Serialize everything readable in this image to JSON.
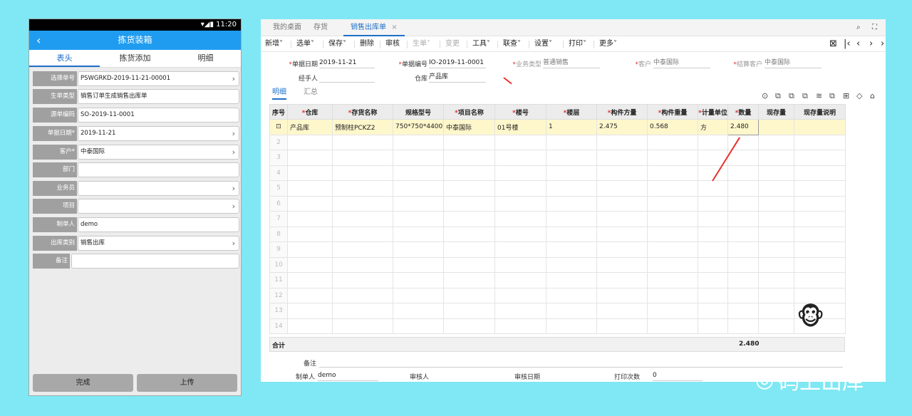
{
  "phone": {
    "status_time": "11:20",
    "status_icons": "▾◢▮",
    "back_icon": "‹",
    "title": "拣货装箱",
    "tabs": [
      "表头",
      "拣货添加",
      "明细"
    ],
    "fields": [
      {
        "label": "选择单号",
        "value": "PSWGRKD-2019-11-21-00001",
        "chevron": true
      },
      {
        "label": "生单类型",
        "value": "销售订单生成销售出库单",
        "chevron": false
      },
      {
        "label": "源单编码",
        "value": "SO-2019-11-0001",
        "chevron": false
      },
      {
        "label": "单据日期*",
        "value": "2019-11-21",
        "chevron": true
      },
      {
        "label": "客户*",
        "value": "中泰国际",
        "chevron": true
      },
      {
        "label": "部门",
        "value": "",
        "chevron": false
      },
      {
        "label": "业务员",
        "value": "",
        "chevron": true
      },
      {
        "label": "项目",
        "value": "",
        "chevron": true
      },
      {
        "label": "制单人",
        "value": "demo",
        "chevron": false
      },
      {
        "label": "出库类别",
        "value": "销售出库",
        "chevron": true
      },
      {
        "label": "备注",
        "value": "",
        "chevron": false
      }
    ],
    "btn_done": "完成",
    "btn_upload": "上传"
  },
  "desk": {
    "tabs": [
      "我的桌面",
      "存货",
      "销售出库单"
    ],
    "tab_close": "×",
    "win_icons": [
      "⌕",
      "⛶"
    ],
    "toolbar": [
      "新增˅",
      "选单˅",
      "保存˅",
      "删除",
      "审核",
      "生单˅",
      "变更",
      "工具˅",
      "联查˅",
      "设置˅",
      "打印˅",
      "更多˅"
    ],
    "toolbar_disabled": [
      5,
      6
    ],
    "nav_icons": [
      "⊠",
      "|‹",
      "‹",
      "›",
      "›"
    ],
    "fields": {
      "date_label": "单据日期",
      "date": "2019-11-21",
      "no_label": "单据编号",
      "no": "IO-2019-11-0001",
      "biztype_label": "业务类型",
      "biztype": "普通销售",
      "cust_label": "客户",
      "cust": "中泰国际",
      "settle_label": "结算客户",
      "settle": "中泰国际",
      "handler_label": "经手人",
      "handler": "",
      "wh_label": "仓库",
      "wh": "产品库"
    },
    "subtabs": [
      "明细",
      "汇总"
    ],
    "grid_icons": [
      "⊙",
      "⧉",
      "⧉",
      "⧉",
      "≋",
      "⧉",
      "⊞",
      "◇",
      "⌂"
    ],
    "columns": [
      "序号",
      "仓库",
      "存货名称",
      "规格型号",
      "项目名称",
      "楼号",
      "楼层",
      "构件方量",
      "构件重量",
      "计量单位",
      "数量",
      "现存量",
      "现存量说明"
    ],
    "required": [
      false,
      true,
      true,
      false,
      true,
      true,
      true,
      true,
      true,
      true,
      true,
      false,
      false
    ],
    "rows": [
      [
        "⊡",
        "产品库",
        "预制柱PCKZ2",
        "750*750*4400",
        "中泰国际",
        "01号楼",
        "1",
        "2.475",
        "0.568",
        "方",
        "2.480",
        "",
        ""
      ]
    ],
    "empty_rows": [
      "2",
      "3",
      "4",
      "5",
      "6",
      "7",
      "8",
      "9",
      "10",
      "11",
      "12",
      "13",
      "14"
    ],
    "sum_label": "合计",
    "sum_qty": "2.480",
    "footer": {
      "remark_label": "备注",
      "maker_label": "制单人",
      "maker": "demo",
      "auditor_label": "审核人",
      "audit_date_label": "审核日期",
      "print_label": "打印次数",
      "print_count": "0"
    },
    "mascot": "🐵"
  },
  "watermark": "码上出库",
  "watermark_icon": "◎"
}
